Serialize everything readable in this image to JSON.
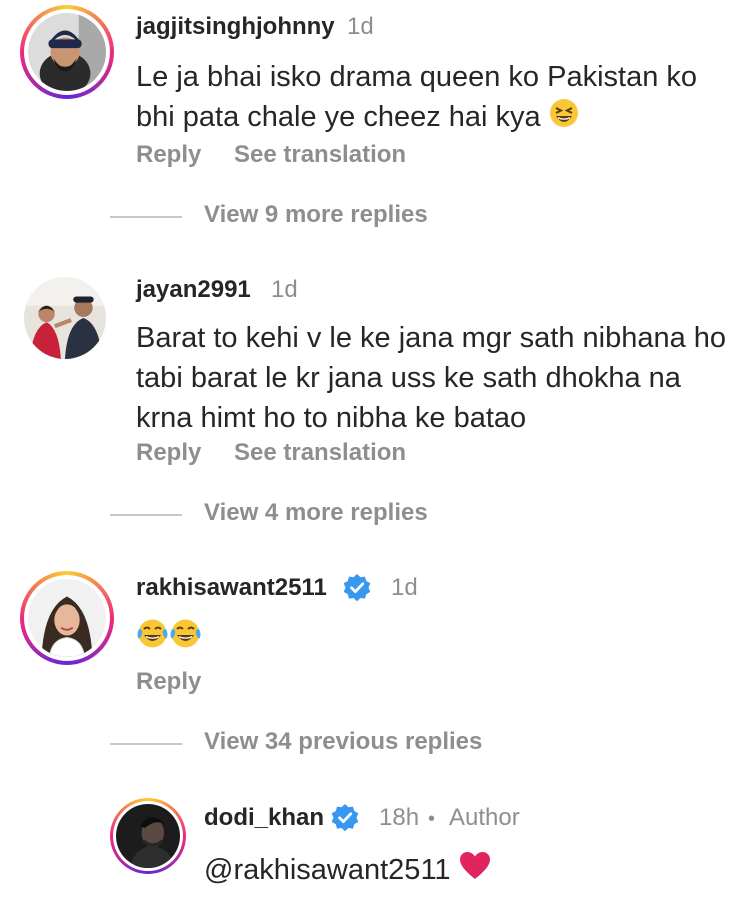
{
  "actions": {
    "reply": "Reply",
    "see_translation": "See translation"
  },
  "comments": [
    {
      "username": "jagjitsinghjohnny",
      "time": "1d",
      "lines": [
        "Le ja bhai isko drama queen ko Pakistan ko",
        "bhi pata chale ye cheez hai kya"
      ],
      "trailing_emoji": "grinning-squinting-face",
      "view_more": "View 9 more replies"
    },
    {
      "username": "jayan2991",
      "time": "1d",
      "lines": [
        "Barat to kehi v le ke jana mgr sath nibhana ho",
        "tabi barat le kr jana uss ke sath dhokha na",
        "krna himt ho to nibha ke batao"
      ],
      "view_more": "View 4 more replies"
    },
    {
      "username": "rakhisawant2511",
      "verified": true,
      "time": "1d",
      "emojis": [
        "face-with-tears-of-joy",
        "face-with-tears-of-joy"
      ],
      "view_more": "View 34 previous replies"
    }
  ],
  "reply": {
    "username": "dodi_khan",
    "verified": true,
    "time": "18h",
    "separator": "•",
    "author_label": "Author",
    "mention": "@rakhisawant2511",
    "trailing_emoji": "red-heart"
  },
  "colors": {
    "text": "#262626",
    "secondary": "#8e8e8e",
    "verified": "#3897f0",
    "heart": "#e0245e"
  }
}
